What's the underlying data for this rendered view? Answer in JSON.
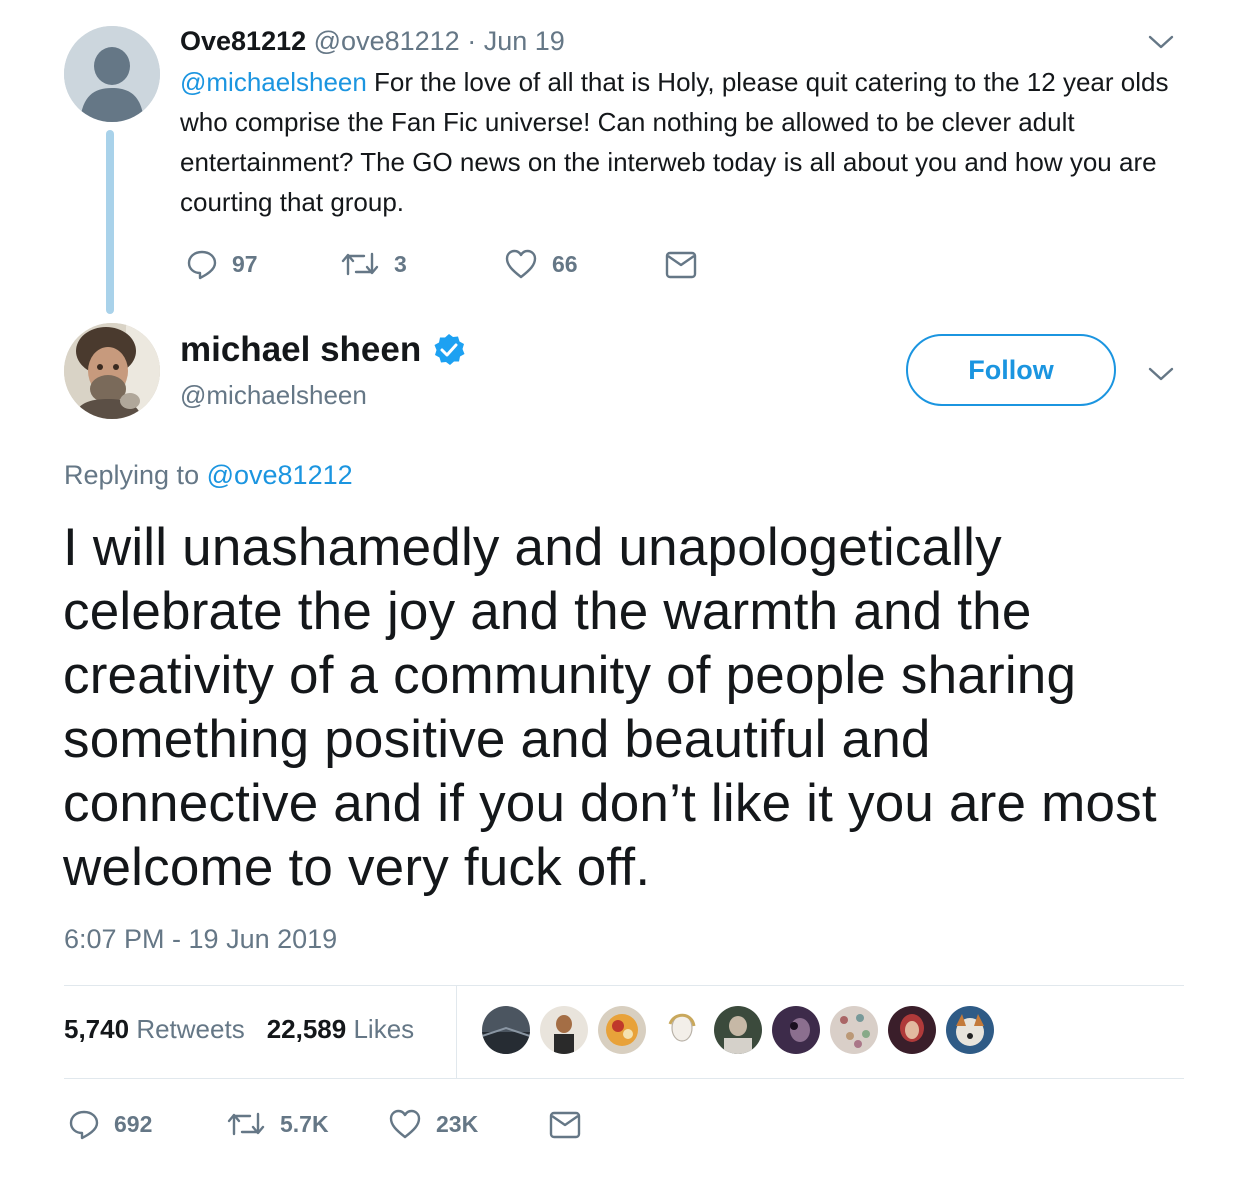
{
  "parent_tweet": {
    "display_name": "Ove81212",
    "handle": "@ove81212",
    "separator": "·",
    "date": "Jun 19",
    "mention": "@michaelsheen",
    "text": " For the love of all that is Holy, please quit catering to the 12 year olds who comprise the Fan Fic universe!  Can nothing be allowed to be clever adult entertainment?  The GO news on the interweb today is all about you and how you are courting that group.",
    "replies": "97",
    "retweets": "3",
    "likes": "66"
  },
  "main_tweet": {
    "display_name": "michael sheen",
    "verified": true,
    "handle": "@michaelsheen",
    "follow_label": "Follow",
    "replying_prefix": "Replying to ",
    "replying_handle": "@ove81212",
    "text": "I will unashamedly and unapologetically celebrate the joy and the warmth and the creativity of a community of people sharing something positive and beautiful and connective and if you don’t like it you are most welcome to very fuck off.",
    "timestamp": "6:07 PM - 19 Jun 2019",
    "retweets_count": "5,740",
    "retweets_label": "Retweets",
    "likes_count": "22,589",
    "likes_label": "Likes",
    "replies": "692",
    "retweets": "5.7K",
    "likes": "23K"
  },
  "colors": {
    "accent": "#1b95e0",
    "muted": "#657786",
    "text": "#14171a",
    "thread_line": "#a9d2ea",
    "verified": "#1da1f2"
  },
  "icons": [
    "reply-icon",
    "retweet-icon",
    "heart-icon",
    "mail-icon",
    "chevron-down-icon",
    "verified-badge-icon"
  ]
}
